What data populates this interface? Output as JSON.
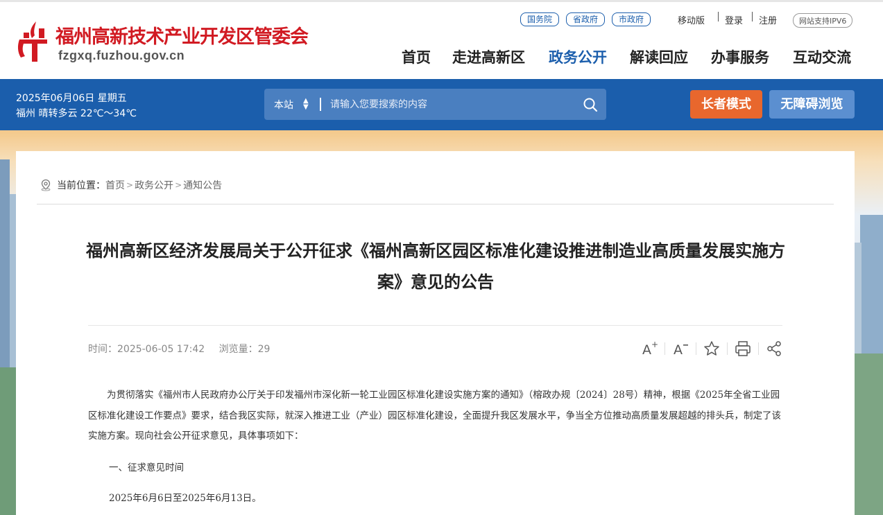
{
  "header": {
    "site_title": "福州高新技术产业开发区管委会",
    "site_domain": "fzgxq.fuzhou.gov.cn",
    "gov_links": [
      "国务院",
      "省政府",
      "市政府"
    ],
    "mobile": "移动版",
    "login": "登录",
    "register": "注册",
    "ipv6": "网站支持IPV6",
    "nav": [
      "首页",
      "走进高新区",
      "政务公开",
      "解读回应",
      "办事服务",
      "互动交流"
    ],
    "active_nav": "政务公开",
    "brand_color": "#d11a22",
    "accent_color": "#1b5eac"
  },
  "bluebar": {
    "date": "2025年06月06日 星期五",
    "weather": "福州 晴转多云 22℃～34℃",
    "search_scope": "本站",
    "search_placeholder": "请输入您要搜索的内容",
    "elder_mode": "长者模式",
    "accessible": "无障碍浏览",
    "elder_color": "#e8672d",
    "access_color": "#5b8fd0"
  },
  "breadcrumb": {
    "label": "当前位置：",
    "items": [
      "首页",
      "政务公开",
      "通知公告"
    ],
    "separator": ">"
  },
  "article": {
    "title": "福州高新区经济发展局关于公开征求《福州高新区园区标准化建设推进制造业高质量发展实施方案》意见的公告",
    "time_label": "时间：",
    "time": "2025-06-05 17:42",
    "views_label": "浏览量：",
    "views": "29",
    "tools": [
      "font-increase-icon",
      "font-decrease-icon",
      "star-icon",
      "print-icon",
      "share-icon"
    ],
    "paragraph_1": "为贯彻落实《福州市人民政府办公厅关于印发福州市深化新一轮工业园区标准化建设实施方案的通知》（榕政办规〔2024〕28号）精神，根据《2025年全省工业园区标准化建设工作要点》要求，结合我区实际，就深入推进工业（产业）园区标准化建设，全面提升我区发展水平，争当全方位推动高质量发展超越的排头兵，制定了该实施方案。现向社会公开征求意见，具体事项如下：",
    "section_1_heading": "一、征求意见时间",
    "section_1_text": "2025年6月6日至2025年6月13日。"
  }
}
